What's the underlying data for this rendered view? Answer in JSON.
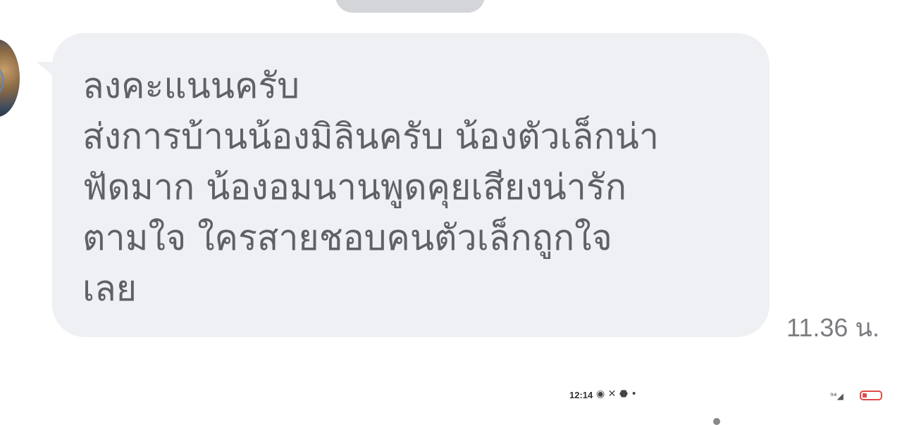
{
  "message": {
    "lines": [
      "ลงคะแนนครับ",
      "ส่งการบ้านน้องมิลินครับ น้องตัวเล็กน่า",
      "ฟัดมาก น้องอมนานพูดคุยเสียงน่ารัก",
      "ตามใจ ใครสายชอบคนตัวเล็กถูกใจ",
      "เลย"
    ],
    "timestamp": "11.36 น."
  },
  "status_bar": {
    "time": "12:14",
    "icons_text": "◉ ✕ ⬣ •",
    "signal_text": "⁹⁴◢",
    "battery_color": "#e04a4a"
  },
  "colors": {
    "bubble_bg": "#eef0f3",
    "text": "#5f6166",
    "timestamp": "#7a7c80"
  }
}
